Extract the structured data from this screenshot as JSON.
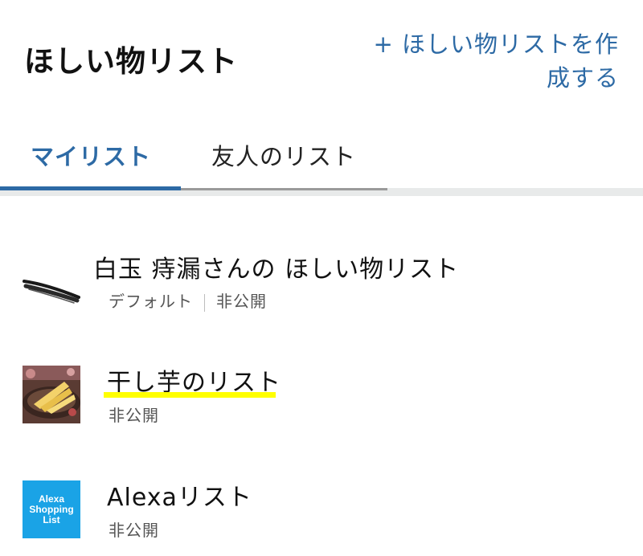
{
  "header": {
    "title": "ほしい物リスト",
    "create_line1": "+ ほしい物リストを作",
    "create_line2": "成する"
  },
  "tabs": [
    {
      "label": "マイリスト",
      "active": true
    },
    {
      "label": "友人のリスト",
      "active": false
    }
  ],
  "lists": [
    {
      "title": "白玉 痔漏さんの ほしい物リスト",
      "meta": [
        "デフォルト",
        "非公開"
      ],
      "icon": "wiper-blade-thumbnail"
    },
    {
      "title": "干し芋のリスト",
      "meta": [
        "非公開"
      ],
      "icon": "dried-sweet-potato-thumbnail",
      "highlighted": true,
      "highlight_color": "#ffff00"
    },
    {
      "title": "Alexaリスト",
      "meta": [
        "非公開"
      ],
      "icon": "alexa-shopping-list-icon",
      "badge_lines": [
        "Alexa",
        "Shopping",
        "List"
      ]
    }
  ],
  "colors": {
    "accent": "#2d6aa5",
    "alexa_blue": "#1aa3e6",
    "highlight": "#ffff00"
  }
}
